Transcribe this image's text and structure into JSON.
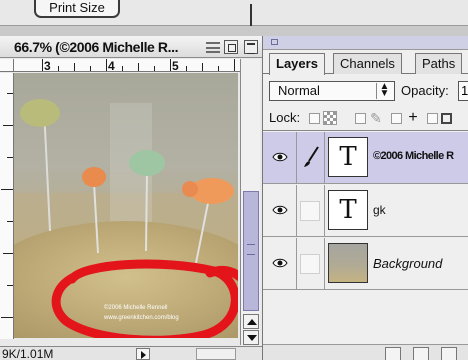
{
  "toolbar": {
    "print_size_label": "Print Size"
  },
  "document": {
    "title": "66.7% (©2006 Michelle R...",
    "ruler_numbers": [
      "3",
      "4",
      "5"
    ],
    "status_text": "9K/1.01M",
    "watermark_line1": "©2006 Michelle Rennell",
    "watermark_line2": "www.greenkitchen.com/blog"
  },
  "layers_panel": {
    "tabs": [
      {
        "label": "Layers",
        "active": true
      },
      {
        "label": "Channels",
        "active": false
      },
      {
        "label": "Paths",
        "active": false
      }
    ],
    "blend_mode": "Normal",
    "opacity_label": "Opacity:",
    "opacity_value": "1",
    "lock_label": "Lock:",
    "layers": [
      {
        "name": "©2006 Michelle R",
        "thumb": "T",
        "visible": true,
        "selected": true
      },
      {
        "name": "gk",
        "thumb": "T",
        "visible": true,
        "selected": false
      },
      {
        "name": "Background",
        "thumb": "image",
        "visible": true,
        "selected": false
      }
    ]
  },
  "colors": {
    "selection": "#cecbe8",
    "scroll_thumb": "#b9b7d9",
    "annotation_red": "#e4141b"
  },
  "icons": [
    "eye-icon",
    "brush-icon",
    "lock-transparency-icon",
    "lock-image-icon",
    "lock-move-icon",
    "lock-all-icon",
    "scroll-up-icon",
    "scroll-down-icon",
    "status-arrow-icon"
  ]
}
